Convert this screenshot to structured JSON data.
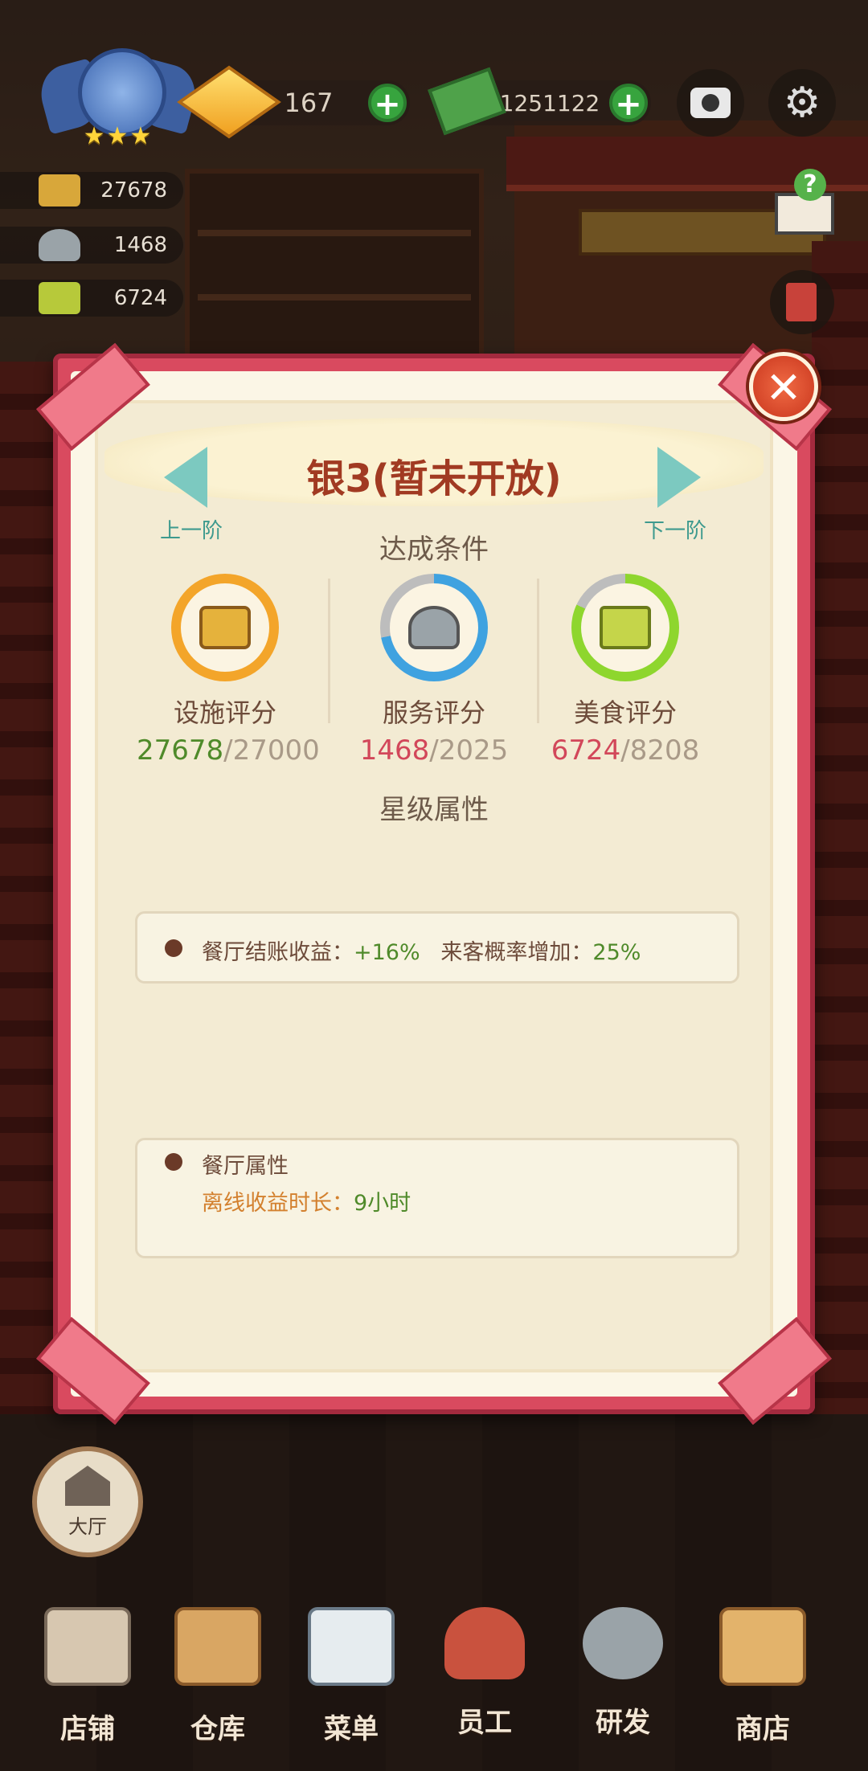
{
  "hud": {
    "stars": "★★★",
    "gems": "167",
    "cash": "1251122",
    "plus": "+",
    "facility_stat": "27678",
    "service_stat": "1468",
    "food_stat": "6724",
    "guide_q": "?"
  },
  "modal": {
    "title": "银3(暂未开放)",
    "prev_label": "上一阶",
    "next_label": "下一阶",
    "close": "✕",
    "conditions_title": "达成条件",
    "scores": [
      {
        "label": "设施评分",
        "current": "27678",
        "required": "27000",
        "progress": 1.0
      },
      {
        "label": "服务评分",
        "current": "1468",
        "required": "2025",
        "progress": 0.72
      },
      {
        "label": "美食评分",
        "current": "6724",
        "required": "8208",
        "progress": 0.82
      }
    ],
    "separator": "/",
    "star_attrs_title": "星级属性",
    "attr1": {
      "checkout_label": "餐厅结账收益：",
      "checkout_value": "+16%",
      "guest_label": "来客概率增加：",
      "guest_value": "25%"
    },
    "attr2": {
      "heading": "餐厅属性",
      "offline_label": "离线收益时长：",
      "offline_value": "9小时"
    }
  },
  "hall": {
    "label": "大厅"
  },
  "nav": [
    {
      "label": "店铺"
    },
    {
      "label": "仓库"
    },
    {
      "label": "菜单"
    },
    {
      "label": "员工"
    },
    {
      "label": "研发"
    },
    {
      "label": "商店"
    }
  ],
  "colors": {
    "frame": "#d94a5f",
    "title": "#a13a22",
    "met": "#4f8a2a",
    "unmet": "#d2475a",
    "offline": "#d3802e"
  }
}
